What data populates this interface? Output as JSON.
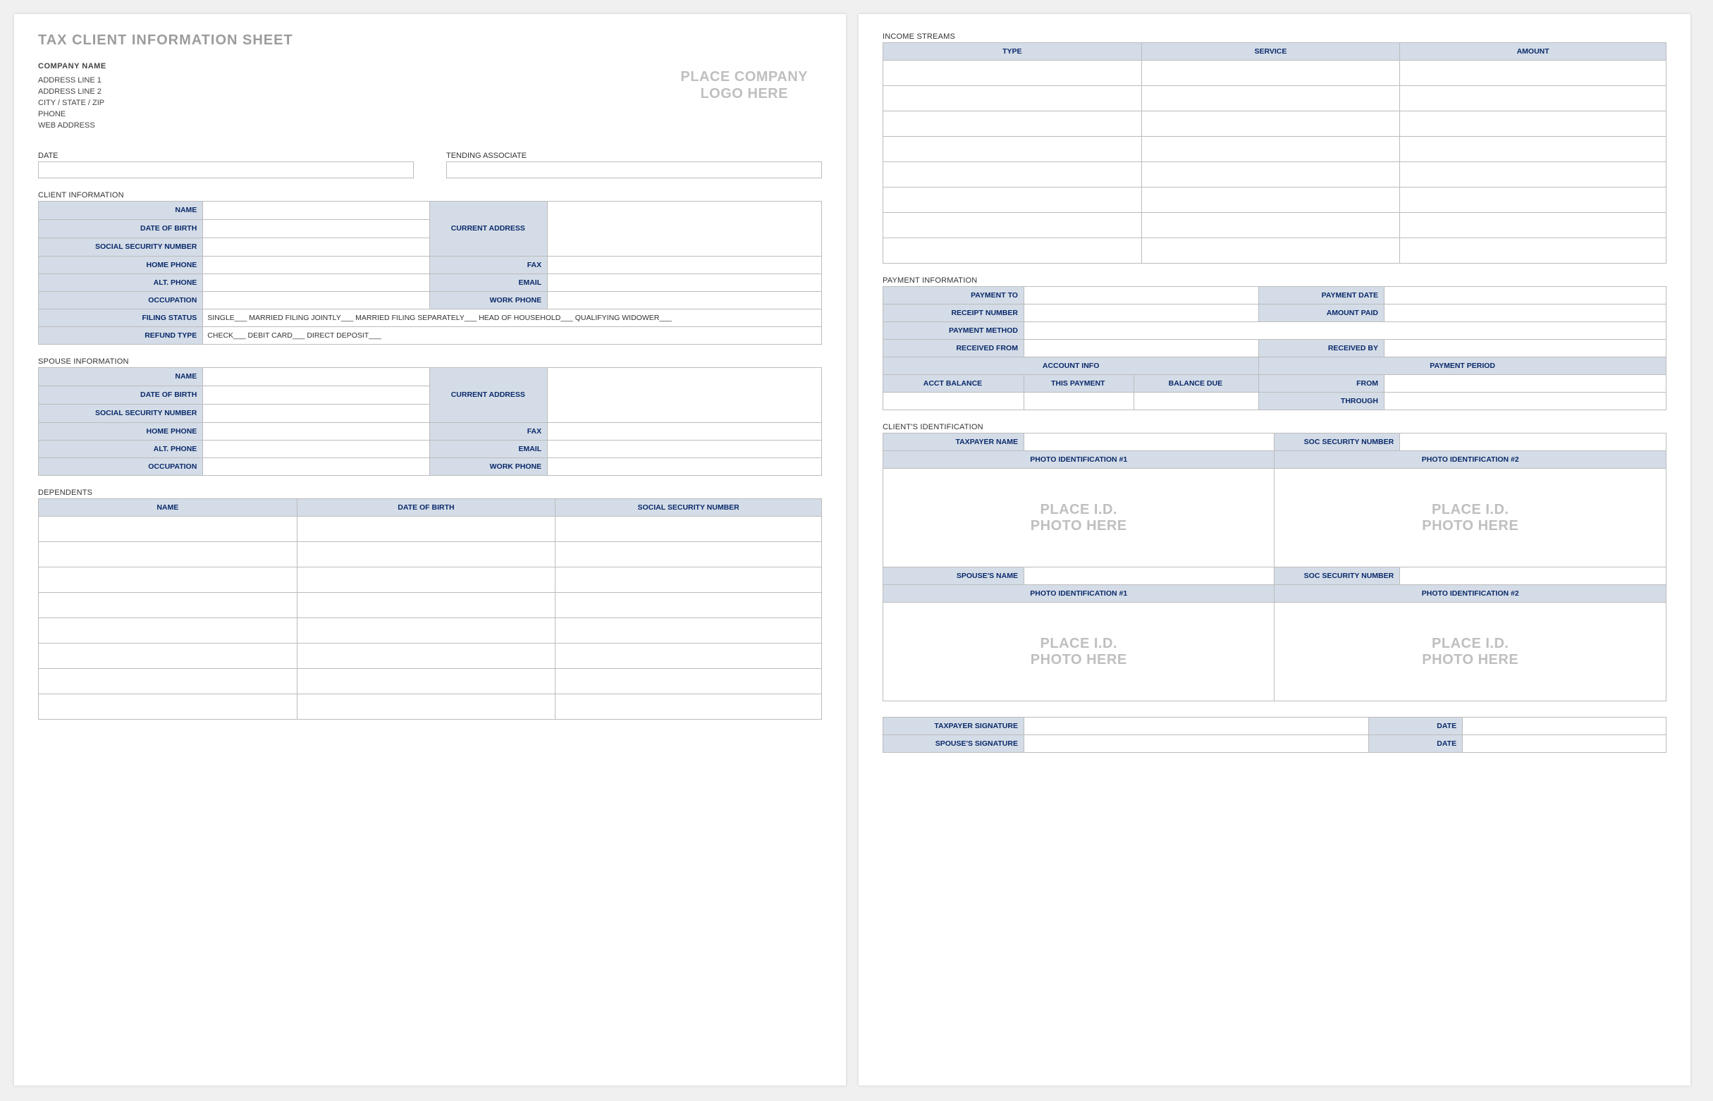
{
  "doc_title": "TAX CLIENT INFORMATION SHEET",
  "company": {
    "name": "COMPANY NAME",
    "addr1": "ADDRESS LINE 1",
    "addr2": "ADDRESS LINE 2",
    "csz": "CITY / STATE / ZIP",
    "phone": "PHONE",
    "web": "WEB ADDRESS"
  },
  "logo_placeholder_l1": "PLACE COMPANY",
  "logo_placeholder_l2": "LOGO HERE",
  "labels": {
    "date": "DATE",
    "tending_associate": "TENDING ASSOCIATE",
    "name": "NAME",
    "dob": "DATE OF BIRTH",
    "ssn": "SOCIAL SECURITY NUMBER",
    "home_phone": "HOME PHONE",
    "alt_phone": "ALT. PHONE",
    "occupation": "OCCUPATION",
    "filing_status": "FILING STATUS",
    "refund_type": "REFUND TYPE",
    "current_address": "CURRENT ADDRESS",
    "fax": "FAX",
    "email": "EMAIL",
    "work_phone": "WORK PHONE",
    "payment_to": "PAYMENT TO",
    "payment_date": "PAYMENT DATE",
    "receipt_number": "RECEIPT NUMBER",
    "amount_paid": "AMOUNT PAID",
    "payment_method": "PAYMENT METHOD",
    "received_from": "RECEIVED FROM",
    "received_by": "RECEIVED BY",
    "account_info": "ACCOUNT INFO",
    "payment_period": "PAYMENT PERIOD",
    "acct_balance": "ACCT BALANCE",
    "this_payment": "THIS PAYMENT",
    "balance_due": "BALANCE DUE",
    "from": "FROM",
    "through": "THROUGH",
    "taxpayer_name": "TAXPAYER NAME",
    "soc_security_number": "SOC SECURITY NUMBER",
    "photo_id_1": "PHOTO IDENTIFICATION #1",
    "photo_id_2": "PHOTO IDENTIFICATION #2",
    "spouses_name": "SPOUSE'S NAME",
    "taxpayer_signature": "TAXPAYER SIGNATURE",
    "spouses_signature": "SPOUSE'S SIGNATURE",
    "sig_date": "DATE"
  },
  "sections": {
    "client_info": "CLIENT INFORMATION",
    "spouse_info": "SPOUSE INFORMATION",
    "dependents": "DEPENDENTS",
    "income_streams": "INCOME STREAMS",
    "payment_info": "PAYMENT INFORMATION",
    "client_id": "CLIENT'S IDENTIFICATION"
  },
  "dependents_headers": {
    "name": "NAME",
    "dob": "DATE OF BIRTH",
    "ssn": "SOCIAL SECURITY NUMBER"
  },
  "income_headers": {
    "type": "TYPE",
    "service": "SERVICE",
    "amount": "AMOUNT"
  },
  "filing_status_text": "SINGLE___   MARRIED FILING JOINTLY___   MARRIED FILING SEPARATELY___   HEAD OF HOUSEHOLD___   QUALIFYING WIDOWER___",
  "refund_type_text": "CHECK___   DEBIT CARD___   DIRECT DEPOSIT___",
  "photo_placeholder_l1": "PLACE I.D.",
  "photo_placeholder_l2": "PHOTO HERE"
}
